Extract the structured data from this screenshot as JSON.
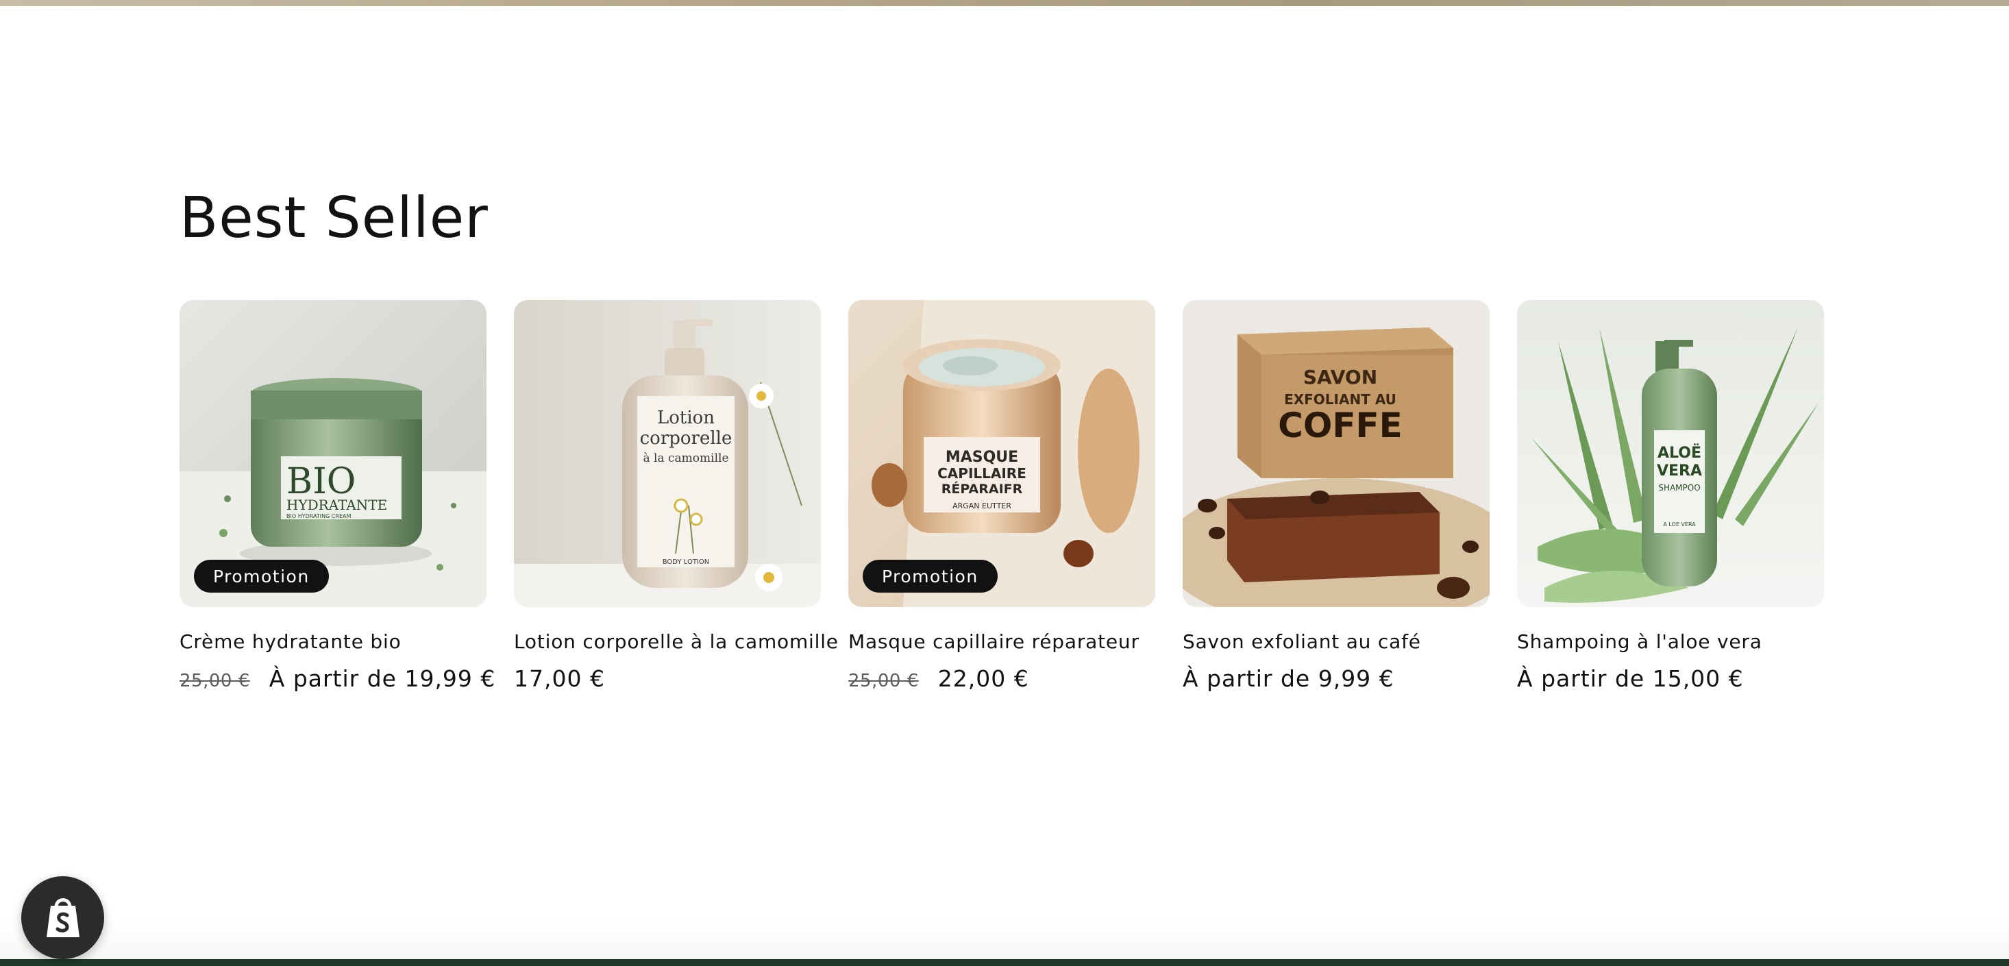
{
  "section": {
    "title": "Best Seller"
  },
  "products": [
    {
      "title": "Crème hydratante bio",
      "badge": "Promotion",
      "compare_price": "25,00 €",
      "price": "À partir de 19,99 €",
      "image": "green-cream-jar"
    },
    {
      "title": "Lotion corporelle à la camomille",
      "badge": "",
      "compare_price": "",
      "price": "17,00 €",
      "image": "lotion-bottle-chamomile"
    },
    {
      "title": "Masque capillaire réparateur",
      "badge": "Promotion",
      "compare_price": "25,00 €",
      "price": "22,00 €",
      "image": "hair-mask-jar"
    },
    {
      "title": "Savon exfoliant au café",
      "badge": "",
      "compare_price": "",
      "price": "À partir de 9,99 €",
      "image": "coffee-soap-box"
    },
    {
      "title": "Shampoing à l'aloe vera",
      "badge": "",
      "compare_price": "",
      "price": "À partir de 15,00 €",
      "image": "aloe-shampoo-bottle"
    }
  ],
  "image_labels": {
    "cream": {
      "line1": "BIO",
      "line2": "HYDRATANTE",
      "line3": "BIO HYDRATING CREAM"
    },
    "lotion": {
      "line1": "Lotion",
      "line2": "corporelle",
      "line3": "à la camomille",
      "line4": "BODY LOTION"
    },
    "mask": {
      "line1": "MASQUE",
      "line2": "CAPILLAIRE",
      "line3": "RÉPARAIFR",
      "line4": "ARGAN EUTTER"
    },
    "soap": {
      "line1": "SAVON",
      "line2": "EXFOLIANT AU",
      "line3": "COFFE"
    },
    "shampoo": {
      "line1": "ALOË",
      "line2": "VERA",
      "line3": "SHAMPOO",
      "line4": "A LOE VERA"
    }
  },
  "icons": {
    "shopify": "shopify-bag-icon"
  },
  "colors": {
    "badge_bg": "#121212",
    "footer": "#1f3a2b"
  }
}
